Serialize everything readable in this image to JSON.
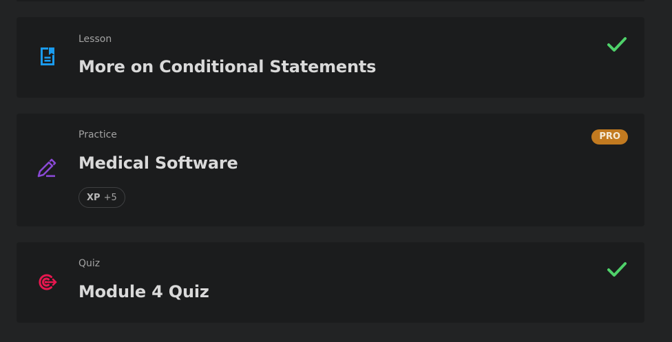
{
  "items": [
    {
      "type_label": "Lesson",
      "title": "More on Conditional Statements",
      "icon": "lesson-document-icon",
      "completed": true
    },
    {
      "type_label": "Practice",
      "title": "Medical Software",
      "icon": "practice-pencil-icon",
      "badge": "PRO",
      "xp": {
        "label": "XP",
        "value": "+5"
      }
    },
    {
      "type_label": "Quiz",
      "title": "Module 4 Quiz",
      "icon": "quiz-target-icon",
      "completed": true
    }
  ],
  "colors": {
    "background": "#222324",
    "card": "#1b1c1d",
    "lesson_icon": "#1a9bef",
    "practice_icon": "#8a49d6",
    "quiz_icon": "#e8174f",
    "check": "#4fd16a",
    "pro_badge": "#c27a20"
  }
}
